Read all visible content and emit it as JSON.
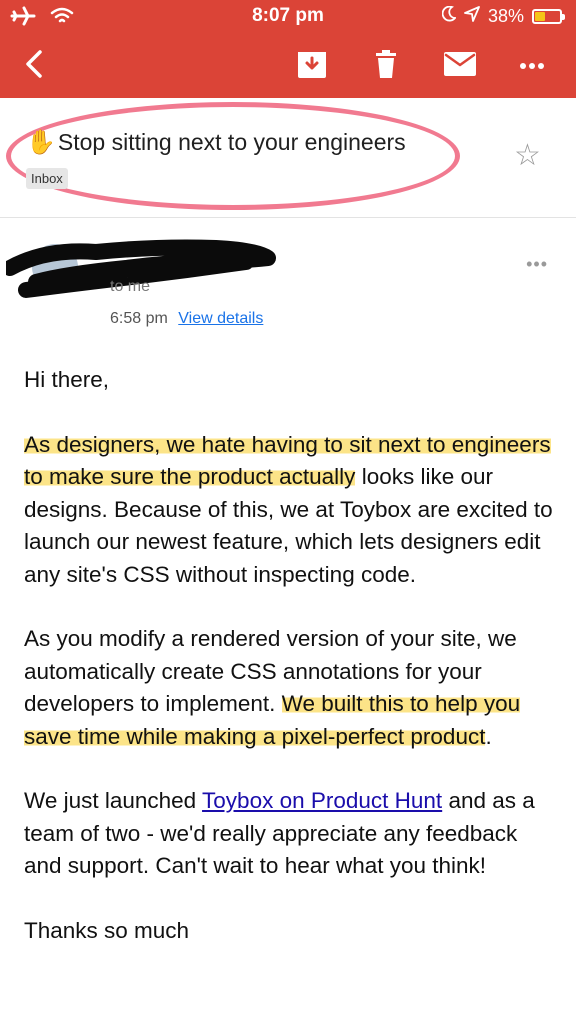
{
  "status_bar": {
    "time": "8:07 pm",
    "battery_percent": "38%",
    "battery_level": 0.38,
    "icons": [
      "airplane-icon",
      "wifi-icon",
      "moon-icon",
      "location-icon",
      "battery-icon"
    ]
  },
  "toolbar": {
    "buttons": [
      "back-icon",
      "archive-icon",
      "delete-icon",
      "mark-unread-icon",
      "more-icon"
    ],
    "accent_color": "#db4437"
  },
  "email": {
    "subject": "Stop sitting next to your engineers",
    "subject_emoji": "✋",
    "label": "Inbox",
    "recipient": "to me",
    "time": "6:58 pm",
    "view_details": "View details",
    "body": {
      "greeting": "Hi there,",
      "p1_highlight": "As designers, we hate having to sit next to engineers to make sure the product actually",
      "p1_rest": " looks like our designs. Because of this, we at Toybox are excited to launch our newest feature, which lets designers edit any site's CSS without inspecting code.",
      "p2_start": "As you modify a rendered version of your site, we automatically create CSS annotations for your developers to implement. ",
      "p2_highlight": "We built this to help you save time while making a pixel-perfect product",
      "p2_end": ".",
      "p3_start": "We just launched ",
      "p3_link": "Toybox on Product Hunt",
      "p3_rest": " and as a team of two - we'd really appreciate any feedback and support. Can't wait to hear what you think!",
      "closing": "Thanks so much"
    }
  }
}
